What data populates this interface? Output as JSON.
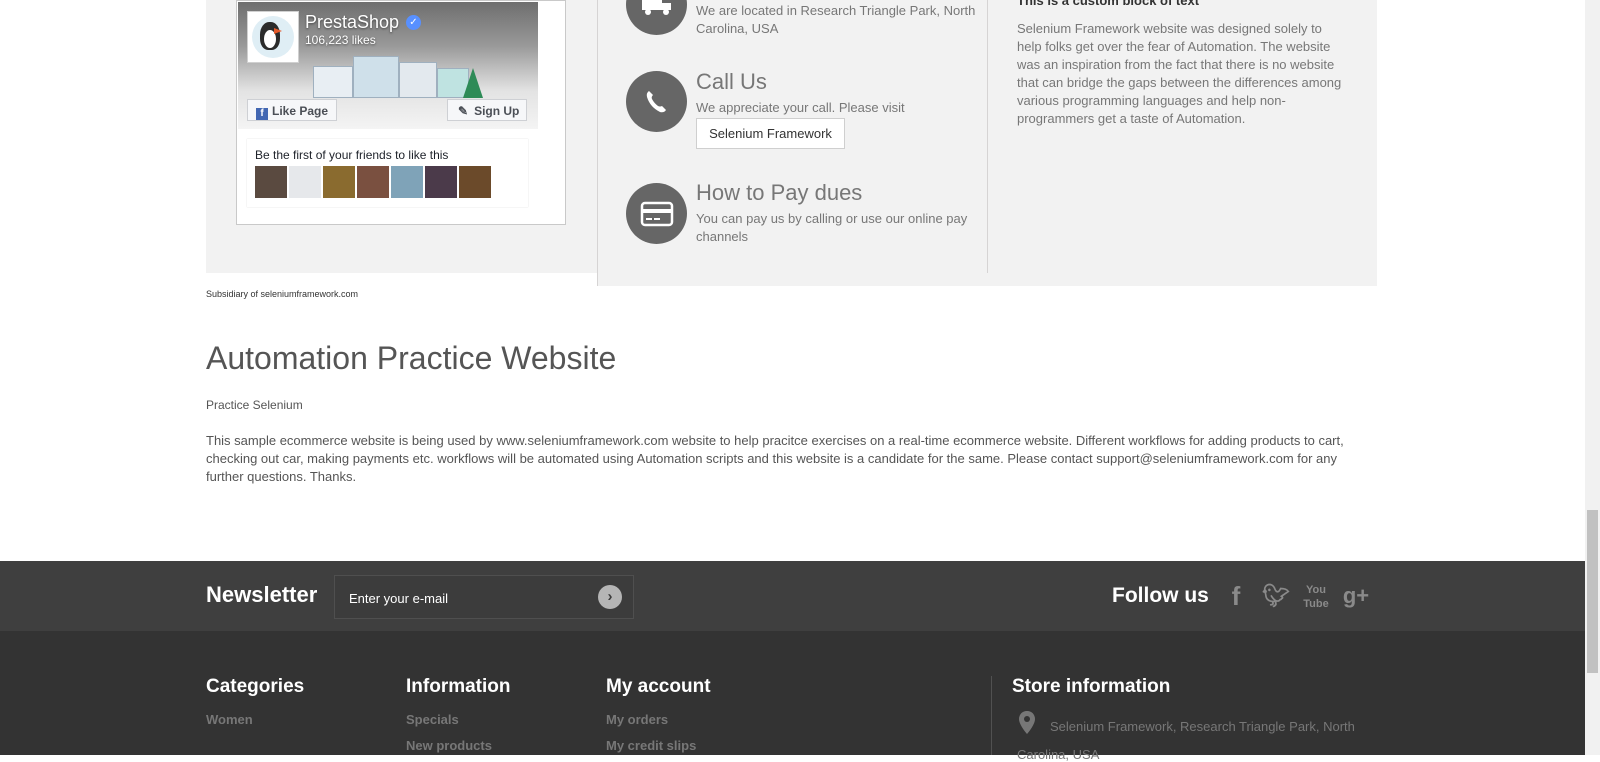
{
  "facebook": {
    "page_name": "PrestaShop",
    "likes": "106,223 likes",
    "like_page": "Like Page",
    "sign_up": "Sign Up",
    "friends_text": "Be the first of your friends to like this"
  },
  "contact": {
    "location_text": "We are located in Research Triangle Park, North Carolina, USA",
    "call_title": "Call Us",
    "call_text": "We appreciate your call. Please visit",
    "call_button": "Selenium Framework",
    "pay_title": "How to Pay dues",
    "pay_text": "You can pay us by calling or use our online pay channels"
  },
  "custom_block": {
    "title": "This is a custom block of text",
    "text": "Selenium Framework website was designed solely to help folks get over the fear of Automation. The website was an inspiration from the fact that there is no website that can bridge the gaps between the differences among various programming languages and help non-programmers get a taste of Automation."
  },
  "subsidiary": "Subsidiary of seleniumframework.com",
  "main": {
    "title": "Automation Practice Website",
    "subtitle": "Practice Selenium",
    "paragraph": "This sample ecommerce website is being used by www.seleniumframework.com website to help pracitce exercises on a real-time ecommerce website. Different workflows for adding products to cart, checking out car, making payments etc. workflows will be automated using Automation scripts and this website is a candidate for the same. Please contact support@seleniumframework.com for any further questions. Thanks."
  },
  "newsletter": {
    "title": "Newsletter",
    "placeholder": "Enter your e-mail",
    "follow_us": "Follow us",
    "social_icons": [
      "facebook-icon",
      "twitter-icon",
      "youtube-icon",
      "google-plus-icon"
    ]
  },
  "footer": {
    "categories": {
      "title": "Categories",
      "links": [
        "Women"
      ]
    },
    "information": {
      "title": "Information",
      "links": [
        "Specials",
        "New products"
      ]
    },
    "my_account": {
      "title": "My account",
      "links": [
        "My orders",
        "My credit slips"
      ]
    },
    "store_information": {
      "title": "Store information",
      "address_line1": "Selenium Framework, Research Triangle Park, North",
      "address_line2": "Carolina, USA"
    }
  },
  "colors": {
    "footer_bg": "#333333",
    "newsletter_bg": "#3f3f3f",
    "panel_bg": "#f2f2f2",
    "icon_circle": "#666666"
  }
}
